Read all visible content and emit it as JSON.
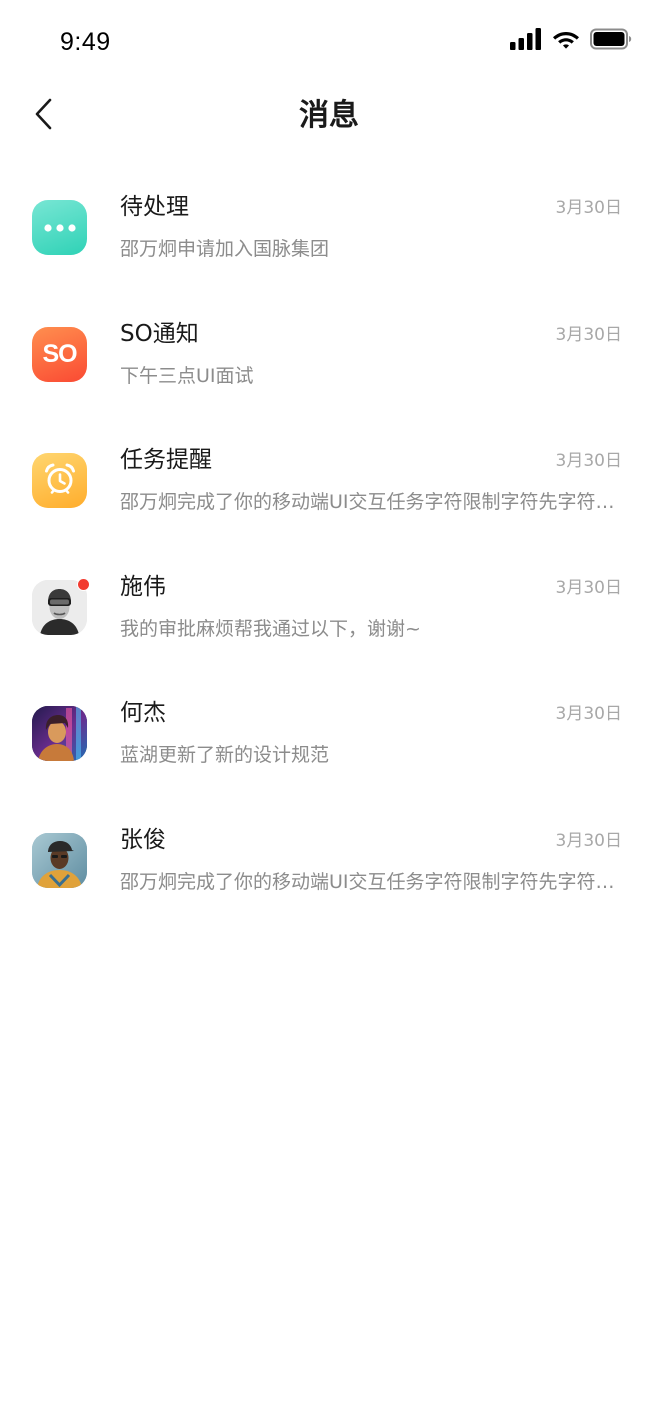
{
  "status_bar": {
    "time": "9:49",
    "icons": [
      "cellular-signal-icon",
      "wifi-icon",
      "battery-icon"
    ]
  },
  "header": {
    "back_icon": "chevron-left-icon",
    "title": "消息"
  },
  "messages": [
    {
      "title": "待处理",
      "date": "3月30日",
      "preview": "邵万炯申请加入国脉集团",
      "avatar": "more-dots-icon",
      "avatar_colors": [
        "#6fe3cf",
        "#2fd3b6"
      ],
      "unread": false
    },
    {
      "title": "SO通知",
      "date": "3月30日",
      "preview": "下午三点UI面试",
      "avatar": "so-logo",
      "avatar_text": "SO",
      "avatar_colors": [
        "#ff8a4c",
        "#fb4b33"
      ],
      "unread": false
    },
    {
      "title": "任务提醒",
      "date": "3月30日",
      "preview": "邵万炯完成了你的移动端UI交互任务字符限制字符先字符限制",
      "avatar": "alarm-clock-icon",
      "avatar_colors": [
        "#ffd46b",
        "#ffae2e"
      ],
      "unread": false
    },
    {
      "title": "施伟",
      "date": "3月30日",
      "preview": "我的审批麻烦帮我通过以下，谢谢~",
      "avatar": "user-photo",
      "unread": true
    },
    {
      "title": "何杰",
      "date": "3月30日",
      "preview": "蓝湖更新了新的设计规范",
      "avatar": "user-photo",
      "unread": false
    },
    {
      "title": "张俊",
      "date": "3月30日",
      "preview": "邵万炯完成了你的移动端UI交互任务字符限制字符先字符限制",
      "avatar": "user-photo",
      "unread": false
    }
  ]
}
